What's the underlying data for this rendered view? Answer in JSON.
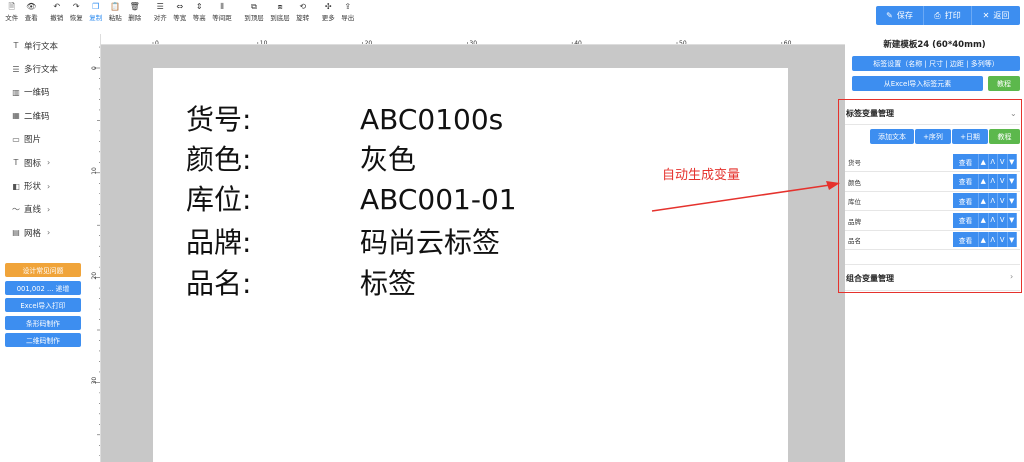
{
  "toolbar": {
    "items": [
      {
        "label": "文件",
        "icon": "file-icon"
      },
      {
        "label": "查看",
        "icon": "eye-icon"
      },
      {
        "label": "撤销",
        "icon": "undo-icon"
      },
      {
        "label": "恢复",
        "icon": "redo-icon"
      },
      {
        "label": "复制",
        "icon": "copy-icon"
      },
      {
        "label": "粘贴",
        "icon": "paste-icon"
      },
      {
        "label": "删除",
        "icon": "trash-icon"
      },
      {
        "label": "对齐",
        "icon": "align-icon"
      },
      {
        "label": "等宽",
        "icon": "equal-width-icon"
      },
      {
        "label": "等高",
        "icon": "equal-height-icon"
      },
      {
        "label": "等间距",
        "icon": "equal-spacing-icon"
      },
      {
        "label": "到顶层",
        "icon": "bring-front-icon"
      },
      {
        "label": "到底层",
        "icon": "send-back-icon"
      },
      {
        "label": "旋转",
        "icon": "rotate-icon"
      },
      {
        "label": "更多",
        "icon": "more-icon"
      },
      {
        "label": "导出",
        "icon": "export-icon"
      }
    ],
    "active": "复制"
  },
  "actions": {
    "save": "保存",
    "print": "打印",
    "back": "返回"
  },
  "sidebar": {
    "items": [
      {
        "label": "单行文本",
        "icon": "text-icon",
        "chevron": false
      },
      {
        "label": "多行文本",
        "icon": "multiline-text-icon",
        "chevron": false
      },
      {
        "label": "一维码",
        "icon": "barcode-icon",
        "chevron": false
      },
      {
        "label": "二维码",
        "icon": "qrcode-icon",
        "chevron": false
      },
      {
        "label": "图片",
        "icon": "image-icon",
        "chevron": false
      },
      {
        "label": "图标",
        "icon": "glyph-icon",
        "chevron": true
      },
      {
        "label": "形状",
        "icon": "shape-icon",
        "chevron": true
      },
      {
        "label": "直线",
        "icon": "line-icon",
        "chevron": true
      },
      {
        "label": "网格",
        "icon": "grid-icon",
        "chevron": true
      }
    ],
    "buttons": [
      {
        "label": "设计常见问题",
        "color": "orange"
      },
      {
        "label": "001,002 ... 递增",
        "color": "blue"
      },
      {
        "label": "Excel导入打印",
        "color": "blue"
      },
      {
        "label": "条形码制作",
        "color": "blue"
      },
      {
        "label": "二维码制作",
        "color": "blue"
      }
    ]
  },
  "ruler": {
    "h_numbers": [
      "0",
      "10",
      "20",
      "30",
      "40",
      "50",
      "60"
    ],
    "v_numbers": [
      "0",
      "10",
      "20",
      "30"
    ]
  },
  "label": {
    "rows": [
      {
        "key": "货号:",
        "value": "ABC0100s"
      },
      {
        "key": "颜色:",
        "value": "灰色"
      },
      {
        "key": "库位:",
        "value": "ABC001-01"
      },
      {
        "key": "品牌:",
        "value": "码尚云标签"
      },
      {
        "key": "品名:",
        "value": "标签"
      }
    ]
  },
  "annotation": {
    "text": "自动生成变量",
    "color": "#e5322d"
  },
  "panel": {
    "template_title": "新建模板24 (60*40mm)",
    "label_settings": "标签设置（名称 | 尺寸 | 边距 | 多列等）",
    "import_excel": "从Excel导入标签元素",
    "tutorial": "教程",
    "var_section": {
      "title": "标签变量管理",
      "buttons": {
        "add_text": "添加文本",
        "add_seq": "+序列",
        "add_date": "+日期",
        "tutorial": "教程"
      },
      "variables": [
        {
          "name": "货号"
        },
        {
          "name": "颜色"
        },
        {
          "name": "库位"
        },
        {
          "name": "品牌"
        },
        {
          "name": "品名"
        }
      ],
      "view_label": "查看",
      "arrows": [
        "▲",
        "Λ",
        "V",
        "▼"
      ]
    },
    "combo_section": {
      "title": "组合变量管理"
    }
  },
  "colors": {
    "primary": "#3d8ef0",
    "green": "#5cb84c",
    "orange": "#f0a43a",
    "red": "#e5322d"
  }
}
